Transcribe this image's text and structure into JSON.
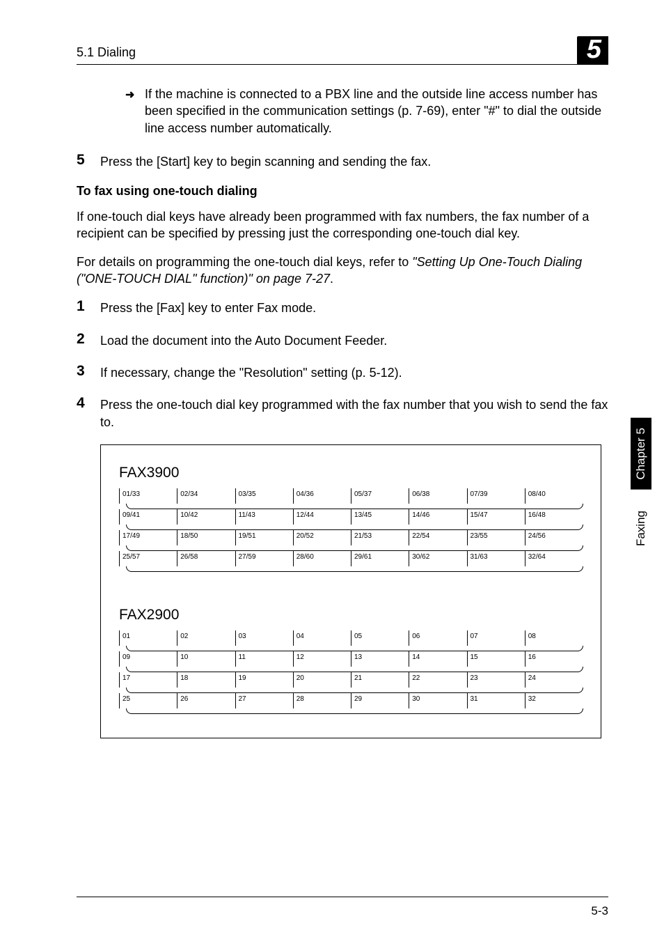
{
  "header": {
    "section": "5.1 Dialing",
    "chapter_badge": "5"
  },
  "arrow_note": "If the machine is connected to a PBX line and the outside line access number has been specified in the communication settings (p. 7-69), enter \"#\" to dial the outside line access number automatically.",
  "step5": {
    "num": "5",
    "text": "Press the [Start] key to begin scanning and sending the fax."
  },
  "subheading": "To fax using one-touch dialing",
  "para1": "If one-touch dial keys have already been programmed with fax numbers, the fax number of a recipient can be specified by pressing just the corresponding one-touch dial key.",
  "para2_a": "For details on programming the one-touch dial keys, refer to ",
  "para2_b": "\"Setting Up One-Touch Dialing (\"ONE-TOUCH DIAL\" function)\" on page 7-27",
  "para2_c": ".",
  "steps": [
    {
      "num": "1",
      "text": "Press the [Fax] key to enter Fax mode."
    },
    {
      "num": "2",
      "text": "Load the document into the Auto Document Feeder."
    },
    {
      "num": "3",
      "text": "If necessary, change the \"Resolution\" setting (p. 5-12)."
    },
    {
      "num": "4",
      "text": "Press the one-touch dial key programmed with the fax number that you wish to send the fax to."
    }
  ],
  "keypads": [
    {
      "title": "FAX3900",
      "rows": [
        [
          "01/33",
          "02/34",
          "03/35",
          "04/36",
          "05/37",
          "06/38",
          "07/39",
          "08/40"
        ],
        [
          "09/41",
          "10/42",
          "11/43",
          "12/44",
          "13/45",
          "14/46",
          "15/47",
          "16/48"
        ],
        [
          "17/49",
          "18/50",
          "19/51",
          "20/52",
          "21/53",
          "22/54",
          "23/55",
          "24/56"
        ],
        [
          "25/57",
          "26/58",
          "27/59",
          "28/60",
          "29/61",
          "30/62",
          "31/63",
          "32/64"
        ]
      ]
    },
    {
      "title": "FAX2900",
      "rows": [
        [
          "01",
          "02",
          "03",
          "04",
          "05",
          "06",
          "07",
          "08"
        ],
        [
          "09",
          "10",
          "11",
          "12",
          "13",
          "14",
          "15",
          "16"
        ],
        [
          "17",
          "18",
          "19",
          "20",
          "21",
          "22",
          "23",
          "24"
        ],
        [
          "25",
          "26",
          "27",
          "28",
          "29",
          "30",
          "31",
          "32"
        ]
      ]
    }
  ],
  "side": {
    "chapter": "Chapter 5",
    "label": "Faxing"
  },
  "footer": "5-3"
}
